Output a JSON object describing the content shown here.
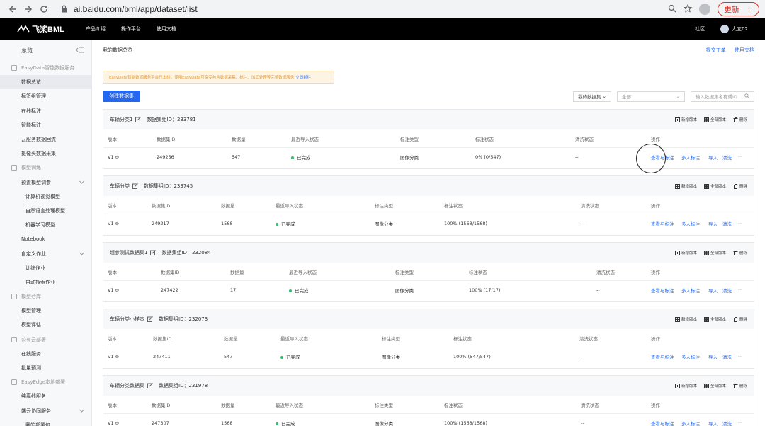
{
  "browser": {
    "url": "ai.baidu.com/bml/app/dataset/list",
    "update_label": "更新"
  },
  "topbar": {
    "logo": "飞桨BML",
    "nav": [
      "产品介绍",
      "操作平台",
      "使用文档"
    ],
    "community": "社区",
    "username": "大立02"
  },
  "sidebar": {
    "title": "总览",
    "items": [
      {
        "type": "group",
        "label": "EasyData智能数据服务"
      },
      {
        "type": "item",
        "label": "数据总览",
        "active": true
      },
      {
        "type": "item",
        "label": "标签组管理"
      },
      {
        "type": "item",
        "label": "在线标注"
      },
      {
        "type": "item",
        "label": "智能标注"
      },
      {
        "type": "item",
        "label": "云服务数据回流"
      },
      {
        "type": "item",
        "label": "摄像头数据采集"
      },
      {
        "type": "group",
        "label": "模型训练"
      },
      {
        "type": "item",
        "label": "预置模型调参",
        "chevron": true
      },
      {
        "type": "sub",
        "label": "计算机视觉模型"
      },
      {
        "type": "sub",
        "label": "自然语言处理模型"
      },
      {
        "type": "sub",
        "label": "机器学习模型"
      },
      {
        "type": "item",
        "label": "Notebook"
      },
      {
        "type": "item",
        "label": "自定义作业",
        "chevron": true
      },
      {
        "type": "sub",
        "label": "训练作业"
      },
      {
        "type": "sub",
        "label": "自动搜索作业"
      },
      {
        "type": "group",
        "label": "模型仓库"
      },
      {
        "type": "item",
        "label": "模型管理"
      },
      {
        "type": "item",
        "label": "模型评估"
      },
      {
        "type": "group",
        "label": "公有云部署"
      },
      {
        "type": "item",
        "label": "在线服务"
      },
      {
        "type": "item",
        "label": "批量预测"
      },
      {
        "type": "group",
        "label": "EasyEdge本地部署"
      },
      {
        "type": "item",
        "label": "纯离线服务"
      },
      {
        "type": "item",
        "label": "端云协同服务",
        "chevron": true
      },
      {
        "type": "sub",
        "label": "我的部署包"
      }
    ]
  },
  "main": {
    "title": "我的数据总览",
    "links": [
      "提交工单",
      "使用文档"
    ],
    "notice": "EasyData智能数据服务平台已上线，使用EasyData可享受包含数据采集、标注、加工处理等完整数据服务",
    "notice_link": "立即前往",
    "create_button": "创建数据集",
    "filter_select": "我的数据集",
    "status_select": "全部",
    "search_placeholder": "输入数据集名称或ID",
    "card_actions": {
      "new_version": "新增版本",
      "all_versions": "全部版本",
      "delete": "删除"
    },
    "columns": [
      "版本",
      "数据集ID",
      "数据量",
      "最近导入状态",
      "标注类型",
      "标注状态",
      "清洗状态",
      "操作"
    ],
    "ops": {
      "view": "查看与标注",
      "multi": "多人标注",
      "import": "导入",
      "clean": "清洗",
      "more": "···"
    },
    "datasets": [
      {
        "name": "车辆分类1",
        "group_label": "数据集组ID：",
        "group_id": "233781",
        "version": "V1",
        "id": "249256",
        "count": "547",
        "import_status": "已完成",
        "label_type": "图像分类",
        "label_status": "0% (0/547)",
        "clean_status": "--"
      },
      {
        "name": "车辆分类",
        "group_label": "数据集组ID：",
        "group_id": "233745",
        "version": "V1",
        "id": "249217",
        "count": "1568",
        "import_status": "已完成",
        "label_type": "图像分类",
        "label_status": "100% (1568/1568)",
        "clean_status": "--"
      },
      {
        "name": "超参测试数据集1",
        "group_label": "数据集组ID：",
        "group_id": "232084",
        "version": "V1",
        "id": "247422",
        "count": "17",
        "import_status": "已完成",
        "label_type": "图像分类",
        "label_status": "100% (17/17)",
        "clean_status": "--"
      },
      {
        "name": "车辆分类小样本",
        "group_label": "数据集组ID：",
        "group_id": "232073",
        "version": "V1",
        "id": "247411",
        "count": "547",
        "import_status": "已完成",
        "label_type": "图像分类",
        "label_status": "100% (547/547)",
        "clean_status": "--"
      },
      {
        "name": "车辆分类数据集",
        "group_label": "数据集组ID：",
        "group_id": "231978",
        "version": "V1",
        "id": "247307",
        "count": "1568",
        "import_status": "已完成",
        "label_type": "图像分类",
        "label_status": "100% (1568/1568)",
        "clean_status": "--"
      }
    ]
  }
}
